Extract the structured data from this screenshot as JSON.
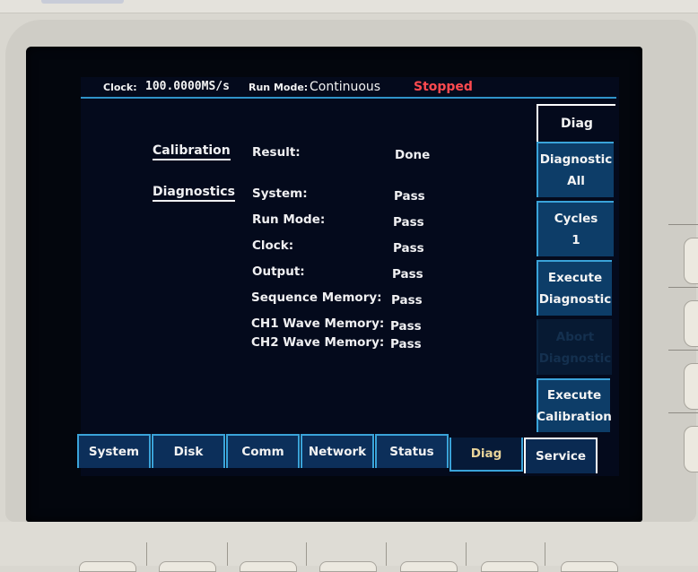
{
  "status_bar": {
    "clock_label": "Clock:",
    "clock_value": "100.0000MS/s",
    "run_mode_label": "Run Mode:",
    "run_mode_value": "Continuous",
    "run_state": "Stopped",
    "run_state_color": "#ff4a4f"
  },
  "calibration": {
    "title": "Calibration",
    "rows": [
      {
        "label": "Result:",
        "value": "Done"
      }
    ]
  },
  "diagnostics": {
    "title": "Diagnostics",
    "rows": [
      {
        "label": "System:",
        "value": "Pass"
      },
      {
        "label": "Run Mode:",
        "value": "Pass"
      },
      {
        "label": "Clock:",
        "value": "Pass"
      },
      {
        "label": "Output:",
        "value": "Pass"
      },
      {
        "label": "Sequence Memory:",
        "value": "Pass"
      },
      {
        "label": "CH1 Wave Memory:",
        "value": "Pass"
      },
      {
        "label": "CH2 Wave Memory:",
        "value": "Pass"
      }
    ]
  },
  "side_menu": {
    "title": "Diag",
    "buttons": [
      {
        "line1": "Diagnostic",
        "line2": "All",
        "enabled": true
      },
      {
        "line1": "Cycles",
        "line2": "1",
        "enabled": true
      },
      {
        "line1": "Execute",
        "line2": "Diagnostic",
        "enabled": true
      },
      {
        "line1": "Abort",
        "line2": "Diagnostic",
        "enabled": false
      },
      {
        "line1": "Execute",
        "line2": "Calibration",
        "enabled": true
      }
    ]
  },
  "tabs": [
    {
      "label": "System",
      "active": false
    },
    {
      "label": "Disk",
      "active": false
    },
    {
      "label": "Comm",
      "active": false
    },
    {
      "label": "Network",
      "active": false
    },
    {
      "label": "Status",
      "active": false
    },
    {
      "label": "Diag",
      "active": true
    },
    {
      "label": "Service",
      "active": false
    }
  ],
  "colors": {
    "accent_blue": "#3aa3d9",
    "button_blue": "#0d3d68",
    "active_tab_text": "#e8d49a"
  }
}
